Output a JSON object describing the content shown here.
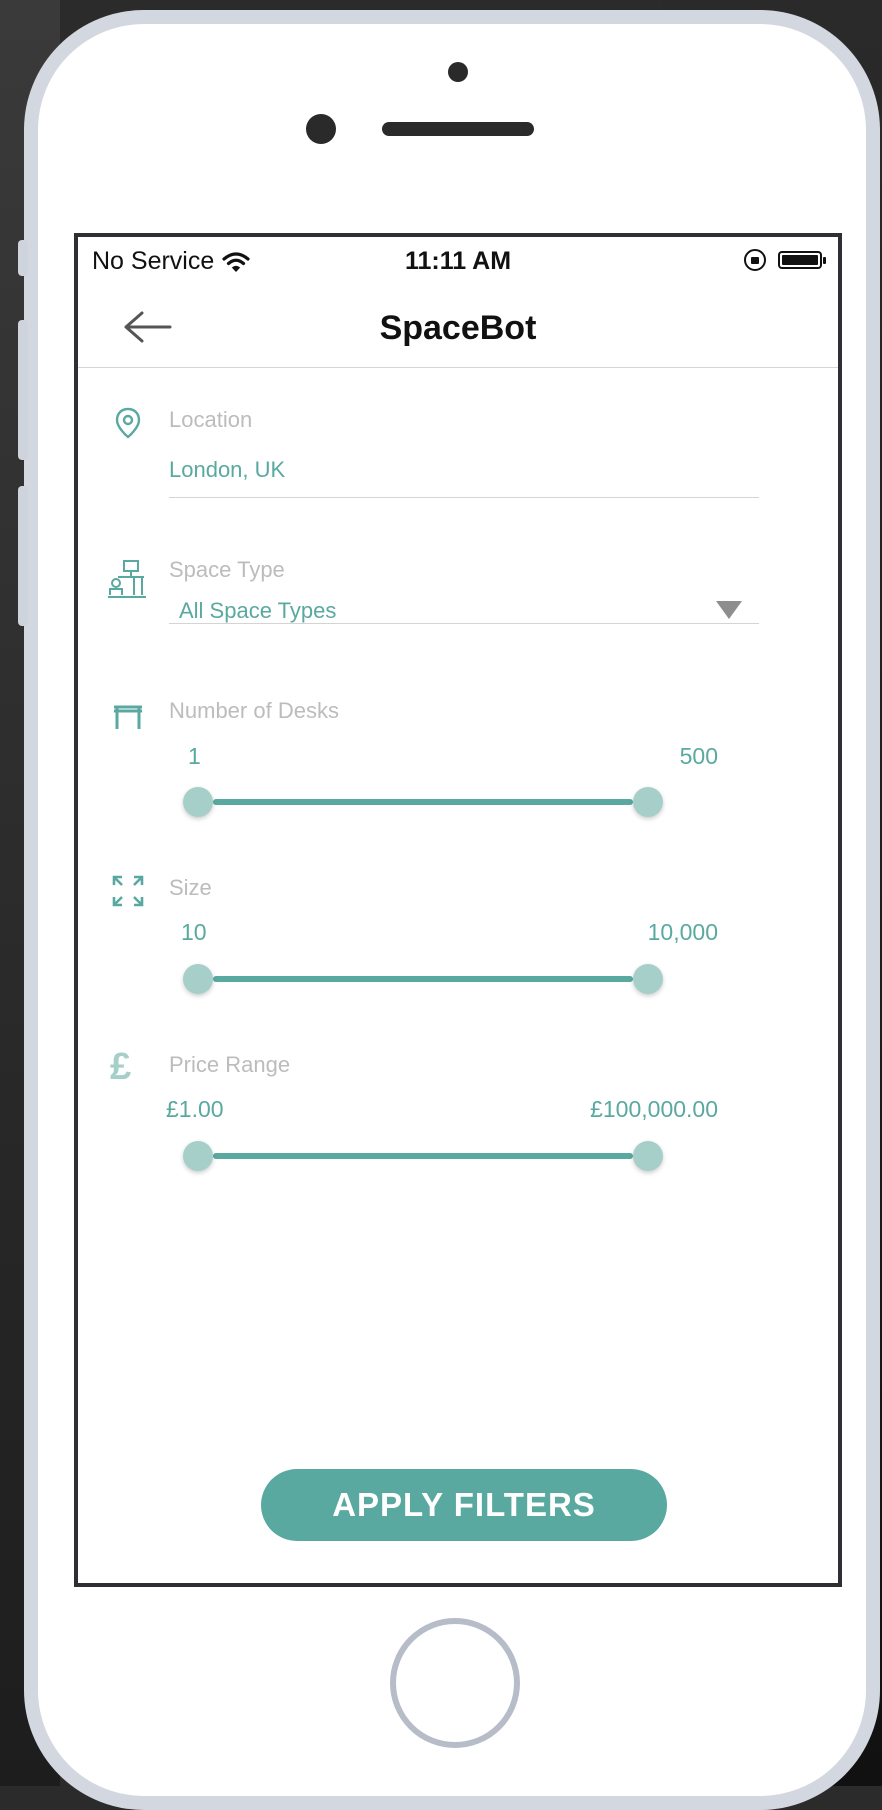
{
  "status_bar": {
    "carrier": "No Service",
    "time": "11:11 AM"
  },
  "app": {
    "title": "SpaceBot"
  },
  "filters": {
    "location": {
      "label": "Location",
      "value": "London, UK"
    },
    "space_type": {
      "label": "Space Type",
      "value": "All Space Types"
    },
    "desks": {
      "label": "Number of Desks",
      "min": "1",
      "max": "500",
      "range_fraction": [
        0,
        1
      ]
    },
    "size": {
      "label": "Size",
      "min": "10",
      "max": "10,000",
      "range_fraction": [
        0,
        1
      ]
    },
    "price": {
      "label": "Price Range",
      "min": "£1.00",
      "max": "£100,000.00",
      "range_fraction": [
        0,
        1
      ]
    }
  },
  "actions": {
    "apply_label": "APPLY FILTERS"
  },
  "colors": {
    "accent": "#5aa9a0",
    "label": "#bcbcbc"
  },
  "icons": {
    "back": "arrow-left-icon",
    "location": "map-pin-icon",
    "space_type": "office-desk-icon",
    "desks": "table-icon",
    "size": "expand-icon",
    "price": "pound-icon"
  }
}
